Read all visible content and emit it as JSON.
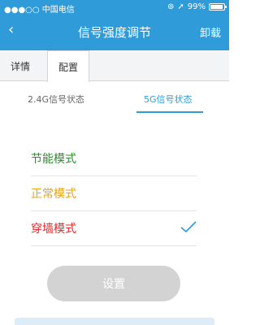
{
  "statusbar": {
    "carrier": "●●●○○ 中国电信",
    "wifi_icon": "wifi-icon",
    "alarm_icon": "alarm-icon",
    "location_icon": "location-arrow-icon",
    "battery_percent": "99%"
  },
  "header": {
    "back_symbol": "‹",
    "title": "信号强度调节",
    "right_action": "卸载"
  },
  "tabs": [
    {
      "label": "详情",
      "active": false
    },
    {
      "label": "配置",
      "active": true
    }
  ],
  "subtabs": [
    {
      "label": "2.4G信号状态",
      "active": false
    },
    {
      "label": "5G信号状态",
      "active": true
    }
  ],
  "modes": [
    {
      "label": "节能模式",
      "color": "#2e8b2e",
      "selected": false
    },
    {
      "label": "正常模式",
      "color": "#e8a317",
      "selected": false
    },
    {
      "label": "穿墙模式",
      "color": "#e02828",
      "selected": true
    }
  ],
  "set_button": {
    "label": "设置",
    "enabled": false
  },
  "colors": {
    "accent": "#2f9bd9",
    "disabled": "#d3d3d3"
  }
}
